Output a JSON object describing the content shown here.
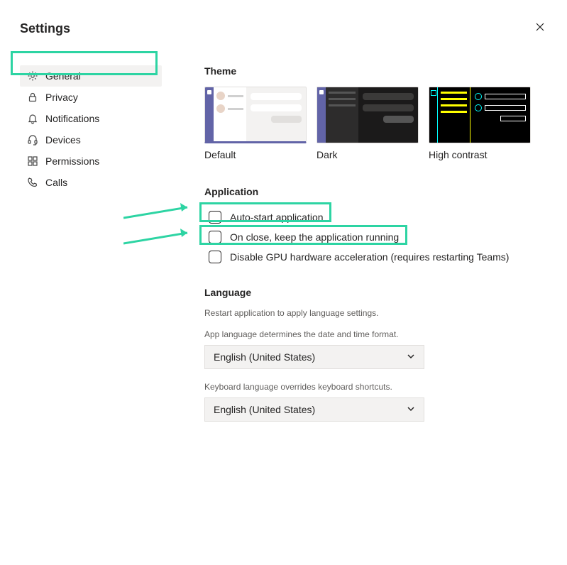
{
  "title": "Settings",
  "sidebar": {
    "items": [
      {
        "label": "General",
        "icon": "gear",
        "active": true
      },
      {
        "label": "Privacy",
        "icon": "lock",
        "active": false
      },
      {
        "label": "Notifications",
        "icon": "bell",
        "active": false
      },
      {
        "label": "Devices",
        "icon": "headset",
        "active": false
      },
      {
        "label": "Permissions",
        "icon": "app",
        "active": false
      },
      {
        "label": "Calls",
        "icon": "phone",
        "active": false
      }
    ]
  },
  "theme": {
    "heading": "Theme",
    "options": [
      {
        "label": "Default",
        "kind": "light",
        "selected": true
      },
      {
        "label": "Dark",
        "kind": "dark",
        "selected": false
      },
      {
        "label": "High contrast",
        "kind": "hc",
        "selected": false
      }
    ]
  },
  "application": {
    "heading": "Application",
    "checks": [
      {
        "label": "Auto-start application",
        "checked": false
      },
      {
        "label": "On close, keep the application running",
        "checked": false
      },
      {
        "label": "Disable GPU hardware acceleration (requires restarting Teams)",
        "checked": false
      }
    ]
  },
  "language": {
    "heading": "Language",
    "restart_hint": "Restart application to apply language settings.",
    "app_lang_label": "App language determines the date and time format.",
    "app_lang_value": "English (United States)",
    "kb_lang_label": "Keyboard language overrides keyboard shortcuts.",
    "kb_lang_value": "English (United States)"
  }
}
